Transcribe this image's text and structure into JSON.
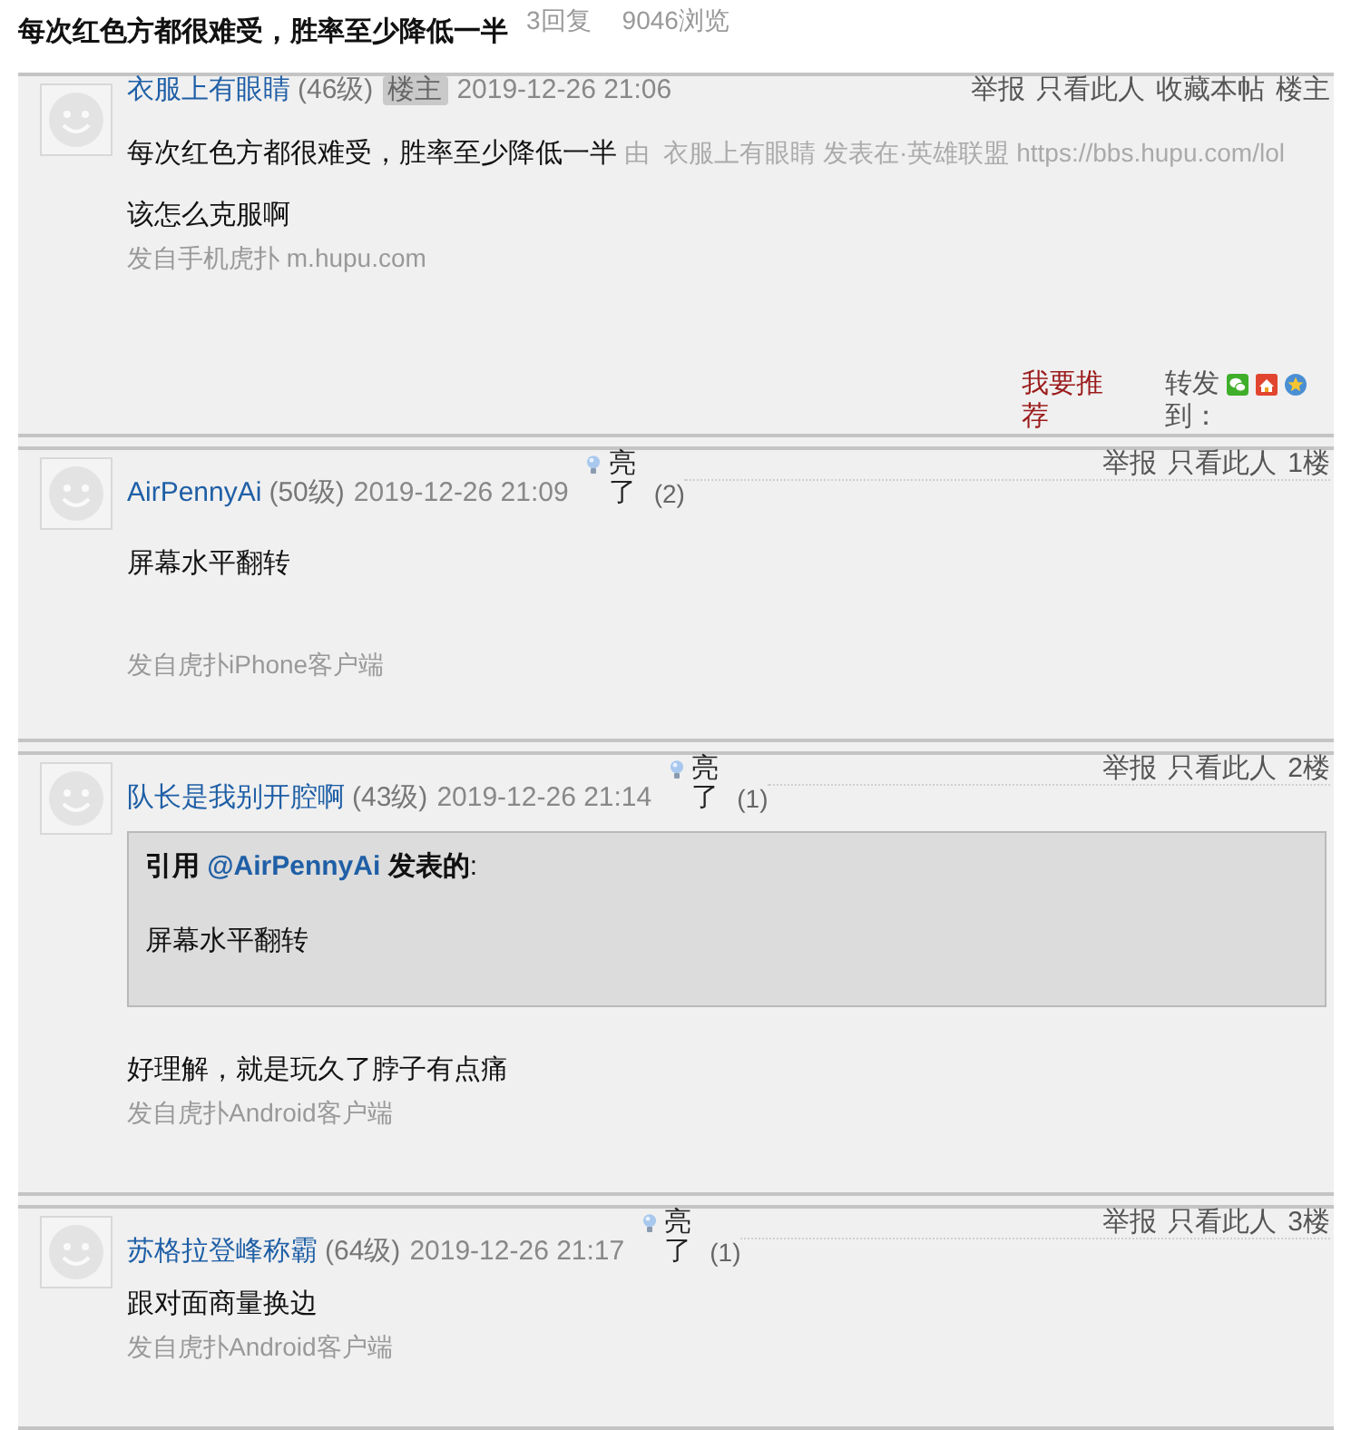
{
  "topic": {
    "title": "每次红色方都很难受，胜率至少降低一半",
    "replies": "3回复",
    "views": "9046浏览"
  },
  "posts": [
    {
      "kind": "topic",
      "author": "衣服上有眼睛",
      "level": "(46级)",
      "badge": "楼主",
      "date": "2019-12-26 21:06",
      "actions": [
        "举报",
        "只看此人",
        "收藏本帖"
      ],
      "floor": "楼主",
      "headline": "每次红色方都很难受，胜率至少降低一半",
      "source": "由  衣服上有眼睛 发表在·英雄联盟 https://bbs.hupu.com/lol",
      "body": "该怎么克服啊",
      "signature": "发自手机虎扑 m.hupu.com",
      "recommend": "我要推荐",
      "share_label": "转发到："
    },
    {
      "kind": "spaced",
      "author": "AirPennyAi",
      "level": "(50级)",
      "date": "2019-12-26 21:09",
      "light": {
        "label": "亮了",
        "count": "(2)"
      },
      "actions": [
        "举报",
        "只看此人"
      ],
      "floor": "1楼",
      "body": "屏幕水平翻转",
      "signature": "发自虎扑iPhone客户端"
    },
    {
      "kind": "compact",
      "author": "队长是我别开腔啊",
      "level": "(43级)",
      "date": "2019-12-26 21:14",
      "light": {
        "label": "亮了",
        "count": "(1)"
      },
      "actions": [
        "举报",
        "只看此人"
      ],
      "floor": "2楼",
      "quote": {
        "lead": "引用",
        "author": "@AirPennyAi",
        "tail": "**发表的**:",
        "text": "屏幕水平翻转"
      },
      "body": "好理解，就是玩久了脖子有点痛",
      "signature": "发自虎扑Android客户端"
    },
    {
      "kind": "compact",
      "author": "苏格拉登峰称霸",
      "level": "(64级)",
      "date": "2019-12-26 21:17",
      "light": {
        "label": "亮了",
        "count": "(1)"
      },
      "actions": [
        "举报",
        "只看此人"
      ],
      "floor": "3楼",
      "body": "跟对面商量换边",
      "signature": "发自虎扑Android客户端"
    }
  ]
}
